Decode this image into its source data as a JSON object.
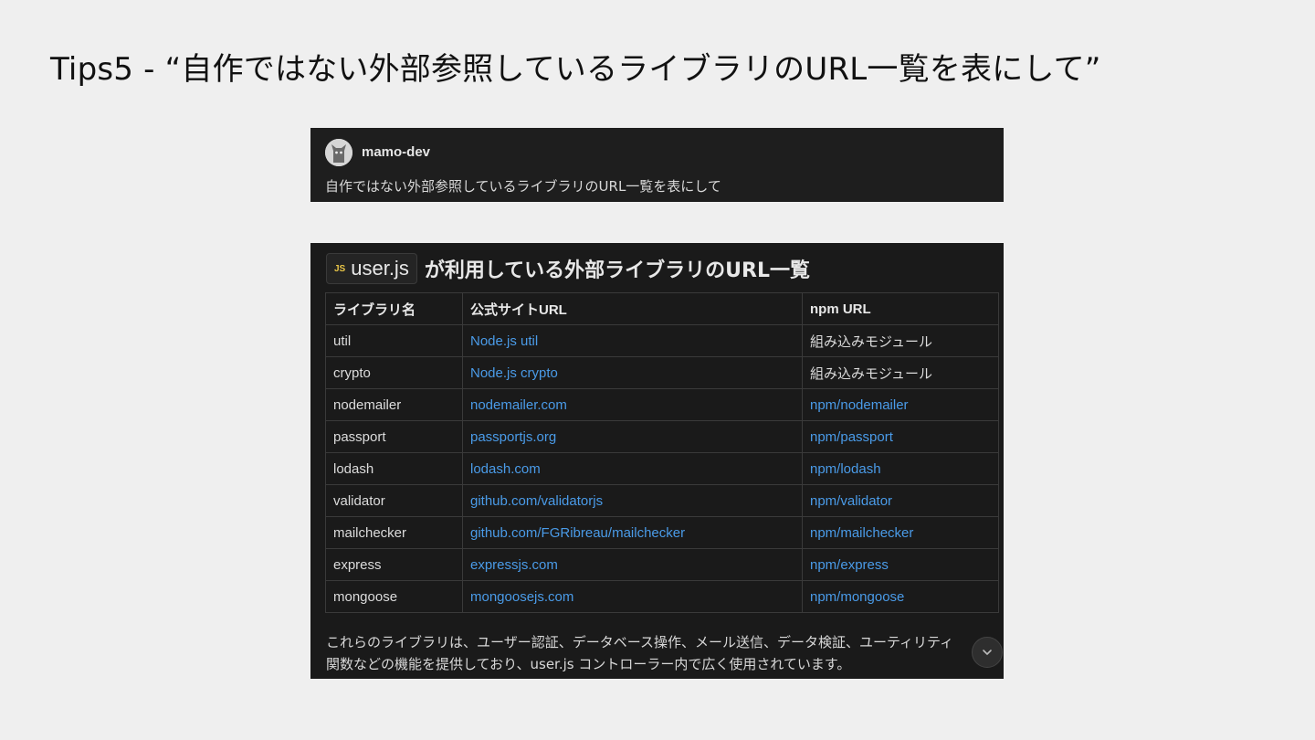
{
  "slide": {
    "title": "Tips5 - “自作ではない外部参照しているライブラリのURL一覧を表にして”"
  },
  "message": {
    "username": "mamo-dev",
    "text": "自作ではない外部参照しているライブラリのURL一覧を表にして",
    "avatar_icon": "cat-avatar-icon"
  },
  "response": {
    "file_icon": "JS",
    "file_name": "user.js",
    "heading": "が利用している外部ライブラリのURL一覧",
    "table": {
      "headers": [
        "ライブラリ名",
        "公式サイトURL",
        "npm URL"
      ],
      "rows": [
        {
          "name": "util",
          "site": "Node.js util",
          "npm": "組み込みモジュール",
          "npm_is_link": false
        },
        {
          "name": "crypto",
          "site": "Node.js crypto",
          "npm": "組み込みモジュール",
          "npm_is_link": false
        },
        {
          "name": "nodemailer",
          "site": "nodemailer.com",
          "npm": "npm/nodemailer",
          "npm_is_link": true
        },
        {
          "name": "passport",
          "site": "passportjs.org",
          "npm": "npm/passport",
          "npm_is_link": true
        },
        {
          "name": "lodash",
          "site": "lodash.com",
          "npm": "npm/lodash",
          "npm_is_link": true
        },
        {
          "name": "validator",
          "site": "github.com/validatorjs",
          "npm": "npm/validator",
          "npm_is_link": true
        },
        {
          "name": "mailchecker",
          "site": "github.com/FGRibreau/mailchecker",
          "npm": "npm/mailchecker",
          "npm_is_link": true
        },
        {
          "name": "express",
          "site": "expressjs.com",
          "npm": "npm/express",
          "npm_is_link": true
        },
        {
          "name": "mongoose",
          "site": "mongoosejs.com",
          "npm": "npm/mongoose",
          "npm_is_link": true
        }
      ]
    },
    "footer_line1": "これらのライブラリは、ユーザー認証、データベース操作、メール送信、データ検証、ユーティリティ",
    "footer_line2": "関数などの機能を提供しており、user.js コントローラー内で広く使用されています。",
    "scroll_icon": "chevron-down-icon"
  },
  "colors": {
    "link": "#4a9be8",
    "panel_bg": "#1a1a1a",
    "js_icon": "#e8c547"
  }
}
